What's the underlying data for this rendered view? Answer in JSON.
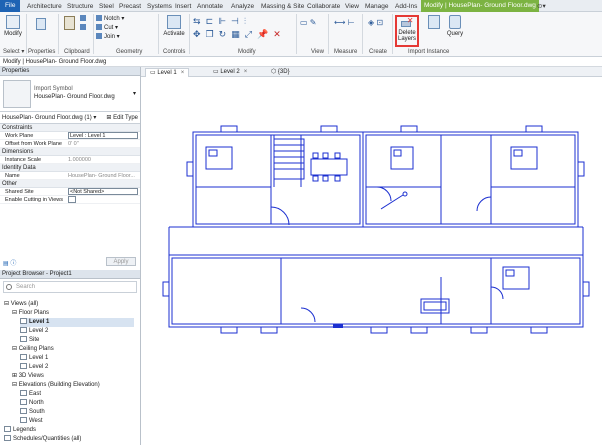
{
  "ribbon_tabs": [
    "File",
    "Architecture",
    "Structure",
    "Steel",
    "Precast",
    "Systems",
    "Insert",
    "Annotate",
    "Analyze",
    "Massing & Site",
    "Collaborate",
    "View",
    "Manage",
    "Add-Ins",
    "Modify | HousePlan- Ground Floor.dwg"
  ],
  "ribbon": {
    "modify": "Modify",
    "select": "Select ▾",
    "properties": "Properties",
    "clipboard": "Clipboard",
    "notch": "Notch",
    "cut": "Cut",
    "join": "Join",
    "geometry": "Geometry",
    "activate": "Activate",
    "controls": "Controls",
    "modify_panel": "Modify",
    "view": "View",
    "measure": "Measure",
    "create": "Create",
    "delete_layers": "Delete\nLayers",
    "query": "Query",
    "import_instance": "Import Instance"
  },
  "status_text": "Modify | HousePlan- Ground Floor.dwg",
  "properties": {
    "title": "Properties",
    "type_line1": "Import Symbol",
    "type_line2": "HousePlan- Ground Floor.dwg",
    "instance": "HousePlan- Ground Floor.dwg (1)",
    "edit_type": "Edit Type",
    "groups": [
      {
        "name": "Constraints",
        "rows": [
          {
            "k": "Work Plane",
            "v": "Level : Level 1",
            "box": true
          },
          {
            "k": "Offset from Work Plane",
            "v": "0' 0\"",
            "box": false
          }
        ]
      },
      {
        "name": "Dimensions",
        "rows": [
          {
            "k": "Instance Scale",
            "v": "1.000000",
            "box": false
          }
        ]
      },
      {
        "name": "Identity Data",
        "rows": [
          {
            "k": "Name",
            "v": "HousePlan- Ground Floor...",
            "box": false
          }
        ]
      },
      {
        "name": "Other",
        "rows": [
          {
            "k": "Shared Site",
            "v": "<Not Shared>",
            "box": true
          },
          {
            "k": "Enable Cutting in Views",
            "v": "",
            "box": true
          }
        ]
      }
    ],
    "apply": "Apply"
  },
  "browser": {
    "title": "Project Browser - Project1",
    "search_placeholder": "Search",
    "items": [
      {
        "label": "Views (all)",
        "indent": 0,
        "sel": false,
        "box": false,
        "prefix": "⊟ "
      },
      {
        "label": "Floor Plans",
        "indent": 1,
        "sel": false,
        "box": false,
        "prefix": "⊟ "
      },
      {
        "label": "Level 1",
        "indent": 2,
        "sel": true,
        "box": true,
        "prefix": ""
      },
      {
        "label": "Level 2",
        "indent": 2,
        "sel": false,
        "box": true,
        "prefix": ""
      },
      {
        "label": "Site",
        "indent": 2,
        "sel": false,
        "box": true,
        "prefix": ""
      },
      {
        "label": "Ceiling Plans",
        "indent": 1,
        "sel": false,
        "box": false,
        "prefix": "⊟ "
      },
      {
        "label": "Level 1",
        "indent": 2,
        "sel": false,
        "box": true,
        "prefix": ""
      },
      {
        "label": "Level 2",
        "indent": 2,
        "sel": false,
        "box": true,
        "prefix": ""
      },
      {
        "label": "3D Views",
        "indent": 1,
        "sel": false,
        "box": false,
        "prefix": "⊞ "
      },
      {
        "label": "Elevations (Building Elevation)",
        "indent": 1,
        "sel": false,
        "box": false,
        "prefix": "⊟ "
      },
      {
        "label": "East",
        "indent": 2,
        "sel": false,
        "box": true,
        "prefix": ""
      },
      {
        "label": "North",
        "indent": 2,
        "sel": false,
        "box": true,
        "prefix": ""
      },
      {
        "label": "South",
        "indent": 2,
        "sel": false,
        "box": true,
        "prefix": ""
      },
      {
        "label": "West",
        "indent": 2,
        "sel": false,
        "box": true,
        "prefix": ""
      },
      {
        "label": "Legends",
        "indent": 0,
        "sel": false,
        "box": true,
        "prefix": ""
      },
      {
        "label": "Schedules/Quantities (all)",
        "indent": 0,
        "sel": false,
        "box": true,
        "prefix": ""
      }
    ]
  },
  "view_tabs": [
    "Level 1",
    "Level 2",
    "{3D}"
  ],
  "colors": {
    "plan_line": "#1b2fd0",
    "file_tab": "#1e63b4",
    "context_tab": "#7cb342",
    "highlight": "#e53935"
  }
}
